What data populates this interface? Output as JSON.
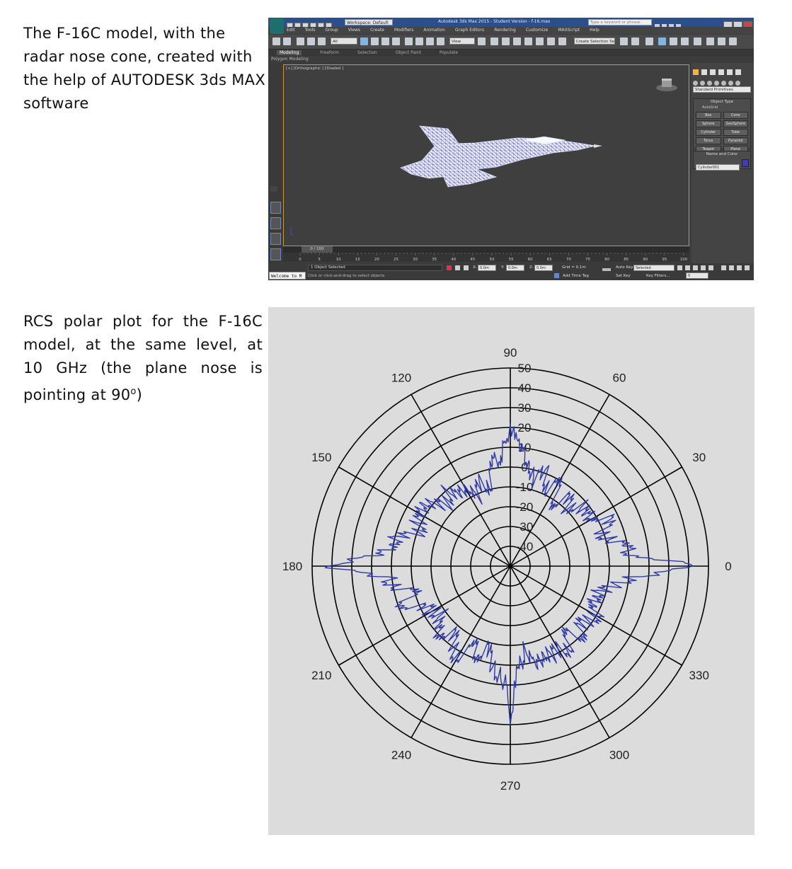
{
  "captions": {
    "top": "The F-16C model, with the radar nose cone, created with the help of AUTODESK 3ds MAX software",
    "bottom_pre": "RCS polar plot for the F-16C model, at the same level, at 10 GHz (the plane nose is pointing at 90",
    "bottom_deg": "o",
    "bottom_post": ")"
  },
  "max_ui": {
    "workspace": "Workspace: Default",
    "window_title": "Autodesk 3ds Max 2015 - Student Version - f-16.max",
    "search_placeholder": "Type a keyword or phrase",
    "menu": [
      "Edit",
      "Tools",
      "Group",
      "Views",
      "Create",
      "Modifiers",
      "Animation",
      "Graph Editors",
      "Rendering",
      "Customize",
      "MAXScript",
      "Help"
    ],
    "selection_filter": "All",
    "ref_coord": "View",
    "named_selection": "Create Selection Se",
    "ribbon_tabs": [
      "Modeling",
      "Freeform",
      "Selection",
      "Object Paint",
      "Populate"
    ],
    "ribbon_sub": "Polygon Modeling",
    "viewport_label": "[+] [Orthographic ] [Shaded ]",
    "command_panel": {
      "category": "Standard Primitives",
      "rollout_object_type": "Object Type",
      "autogrid": "AutoGrid",
      "primitives": [
        "Box",
        "Cone",
        "Sphere",
        "GeoSphere",
        "Cylinder",
        "Tube",
        "Torus",
        "Pyramid",
        "Teapot",
        "Plane"
      ],
      "rollout_name_color": "Name and Color",
      "object_name": "Cylinder001"
    },
    "time_slider": "0 / 100",
    "track_ticks": [
      "0",
      "5",
      "10",
      "15",
      "20",
      "25",
      "30",
      "35",
      "40",
      "45",
      "50",
      "55",
      "60",
      "65",
      "70",
      "75",
      "80",
      "85",
      "90",
      "95",
      "100"
    ],
    "status": {
      "selected": "1 Object Selected",
      "prompt": "Click or click-and-drag to select objects",
      "x": "0.0m",
      "y": "0.0m",
      "z": "0.0m",
      "grid": "Grid = 0.1m",
      "add_time_tag": "Add Time Tag",
      "auto_key": "Auto Key",
      "set_key": "Set Key",
      "key_mode": "Selected",
      "key_filters": "Key Filters...",
      "frame": "0"
    },
    "listener": "Welcome to M"
  },
  "chart_data": {
    "type": "polar",
    "title": "",
    "angle_unit": "degrees",
    "angle_ticks": [
      0,
      30,
      60,
      90,
      120,
      150,
      180,
      210,
      240,
      270,
      300,
      330
    ],
    "radial_ticks": [
      -40,
      -30,
      -20,
      -10,
      0,
      10,
      20,
      30,
      40,
      50
    ],
    "radial_range": [
      -50,
      50
    ],
    "grid": true,
    "series": [
      {
        "name": "",
        "color": "#2f3aa8",
        "theta": [
          0,
          5,
          10,
          15,
          20,
          25,
          30,
          35,
          40,
          45,
          50,
          55,
          60,
          65,
          70,
          75,
          80,
          85,
          88,
          90,
          92,
          95,
          100,
          105,
          110,
          115,
          120,
          125,
          130,
          135,
          140,
          145,
          150,
          155,
          160,
          165,
          170,
          175,
          180,
          185,
          190,
          195,
          200,
          205,
          210,
          215,
          220,
          225,
          230,
          235,
          240,
          245,
          250,
          255,
          260,
          265,
          268,
          270,
          272,
          275,
          280,
          285,
          290,
          295,
          300,
          305,
          310,
          315,
          320,
          325,
          330,
          335,
          340,
          345,
          350,
          355
        ],
        "r": [
          42,
          12,
          8,
          2,
          -2,
          6,
          0,
          -6,
          -2,
          -10,
          -4,
          -12,
          -2,
          -8,
          2,
          -6,
          4,
          8,
          14,
          22,
          12,
          6,
          2,
          -10,
          -4,
          -12,
          -2,
          -8,
          0,
          -6,
          -2,
          6,
          0,
          2,
          -2,
          8,
          12,
          14,
          42,
          12,
          10,
          0,
          8,
          -2,
          -4,
          -8,
          0,
          -2,
          -6,
          0,
          4,
          -6,
          -2,
          -8,
          2,
          6,
          10,
          30,
          8,
          2,
          -8,
          4,
          -4,
          0,
          -2,
          2,
          -6,
          0,
          -4,
          -2,
          0,
          -2,
          -6,
          -2,
          4,
          12
        ]
      }
    ]
  }
}
